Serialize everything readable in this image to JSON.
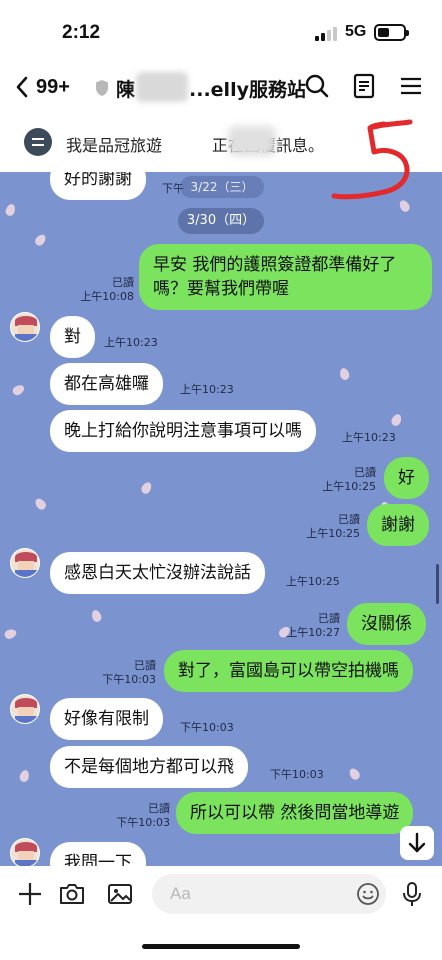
{
  "status_bar": {
    "time": "2:12",
    "network": "5G",
    "battery_level": 0.45
  },
  "header": {
    "back_count": "99+",
    "title_start": "陳",
    "title_end": "...elly服務站",
    "icons": [
      "chevron-left-icon",
      "shield-icon",
      "search-icon",
      "notes-icon",
      "menu-icon"
    ]
  },
  "notice": {
    "text_start": "我是品冠旅遊",
    "text_end": "正在回覆訊息。"
  },
  "annotation_mark": "5",
  "chat": {
    "date_prev_partial": "3/22（三）",
    "date_chip": "3/30（四）",
    "first_partial": {
      "text": "好的謝謝",
      "time_partial": "下午"
    },
    "messages": [
      {
        "dir": "out",
        "text": "早安 我們的護照簽證都準備好了嗎？要幫我們帶喔",
        "read": "已讀",
        "time": "上午10:08"
      },
      {
        "dir": "in",
        "text": "對",
        "time": "上午10:23"
      },
      {
        "dir": "in",
        "text": "都在高雄囉",
        "time": "上午10:23"
      },
      {
        "dir": "in",
        "text": "晚上打給你說明注意事項可以嗎",
        "time": "上午10:23"
      },
      {
        "dir": "out",
        "text": "好",
        "read": "已讀",
        "time": "上午10:25"
      },
      {
        "dir": "out",
        "text": "謝謝",
        "read": "已讀",
        "time": "上午10:25"
      },
      {
        "dir": "in",
        "text": "感恩白天太忙沒辦法說話",
        "time": "上午10:25"
      },
      {
        "dir": "out",
        "text": "沒關係",
        "read": "已讀",
        "time": "上午10:27"
      },
      {
        "dir": "out",
        "text": "對了，富國島可以帶空拍機嗎",
        "read": "已讀",
        "time": "下午10:03"
      },
      {
        "dir": "in",
        "text": "好像有限制",
        "time": "下午10:03"
      },
      {
        "dir": "in",
        "text": "不是每個地方都可以飛",
        "time": "下午10:03"
      },
      {
        "dir": "out",
        "text": "所以可以帶 然後問當地導遊",
        "read": "已讀",
        "time": "下午10:03"
      },
      {
        "dir": "in",
        "text": "我問一下",
        "time": ""
      }
    ]
  },
  "input_bar": {
    "placeholder": "Aa",
    "icons": [
      "plus-icon",
      "camera-icon",
      "image-icon",
      "emoji-icon",
      "microphone-icon"
    ]
  },
  "colors": {
    "chat_background": "#7b93cf",
    "outgoing_bubble": "#7ce35f",
    "incoming_bubble": "#ffffff",
    "annotation": "#e3292b"
  }
}
